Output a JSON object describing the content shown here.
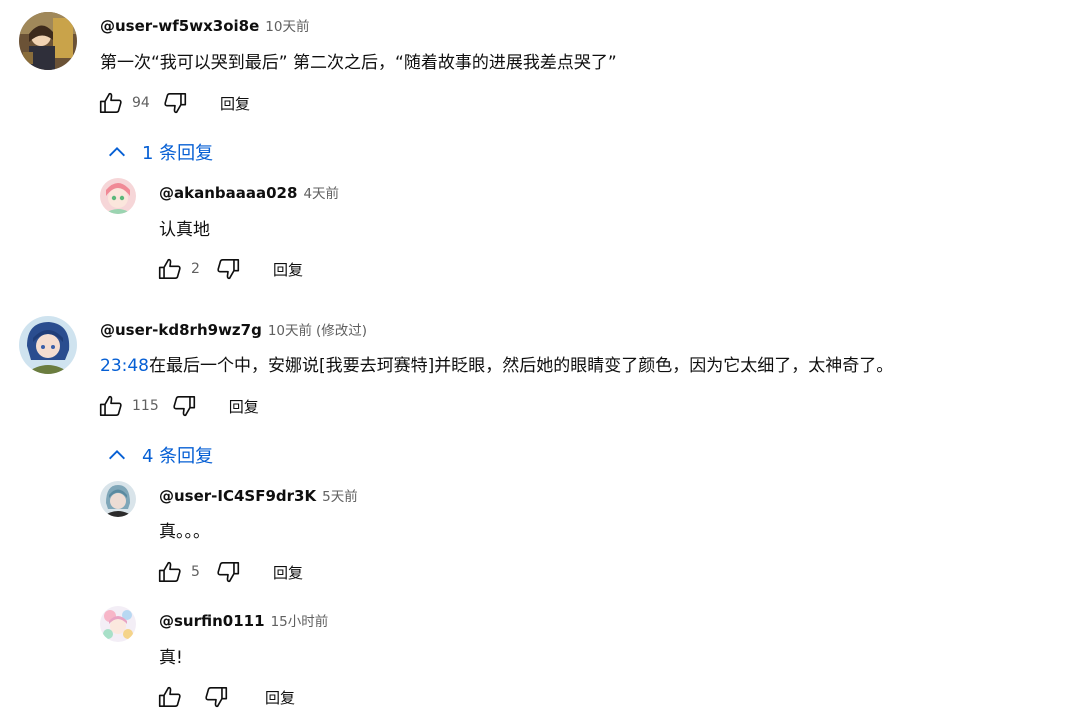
{
  "comments": [
    {
      "author": "@user-wf5wx3oi8e",
      "time": "10天前",
      "text": "第一次“我可以哭到最后” 第二次之后，“随着故事的进展我差点哭了”",
      "likes": "94",
      "reply_label": "回复",
      "replies_toggle": "1 条回复",
      "avatar_icon": "avatar-icon",
      "replies": [
        {
          "author": "@akanbaaaa028",
          "time": "4天前",
          "text": "认真地",
          "likes": "2",
          "reply_label": "回复"
        }
      ]
    },
    {
      "author": "@user-kd8rh9wz7g",
      "time": "10天前",
      "edited": "(修改过)",
      "timestamp_link": "23:48",
      "text": "在最后一个中，安娜说[我要去珂赛特]并眨眼，然后她的眼睛变了颜色，因为它太细了，太神奇了。",
      "likes": "115",
      "reply_label": "回复",
      "replies_toggle": "4 条回复",
      "replies": [
        {
          "author": "@user-IC4SF9dr3K",
          "time": "5天前",
          "text": "真。。。",
          "likes": "5",
          "reply_label": "回复"
        },
        {
          "author": "@surfin0111",
          "time": "15小时前",
          "text": "真!",
          "likes": "",
          "reply_label": "回复"
        }
      ]
    }
  ],
  "colors": {
    "link": "#065fd4",
    "text": "#0f0f0f",
    "meta": "#606060"
  }
}
